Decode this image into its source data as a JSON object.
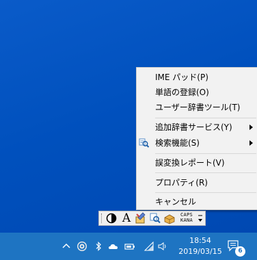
{
  "menu": {
    "items": [
      {
        "label": "IME パッド(P)",
        "has_submenu": false
      },
      {
        "label": "単語の登録(O)",
        "has_submenu": false
      },
      {
        "label": "ユーザー辞書ツール(T)",
        "has_submenu": false
      },
      {
        "label": "追加辞書サービス(Y)",
        "has_submenu": true
      },
      {
        "label": "検索機能(S)",
        "has_submenu": true,
        "icon": "search-function-icon"
      },
      {
        "label": "誤変換レポート(V)",
        "has_submenu": false
      },
      {
        "label": "プロパティ(R)",
        "has_submenu": false
      },
      {
        "label": "キャンセル",
        "has_submenu": false
      }
    ]
  },
  "langbar": {
    "mode_glyph": "A",
    "caps_label": "CAPS",
    "kana_label": "KANA"
  },
  "taskbar": {
    "time": "18:54",
    "date": "2019/03/15",
    "notification_count": "6"
  },
  "colors": {
    "desktop": "#0050bd",
    "taskbar": "#1e74c2",
    "menu_bg": "#f2f2f2"
  }
}
